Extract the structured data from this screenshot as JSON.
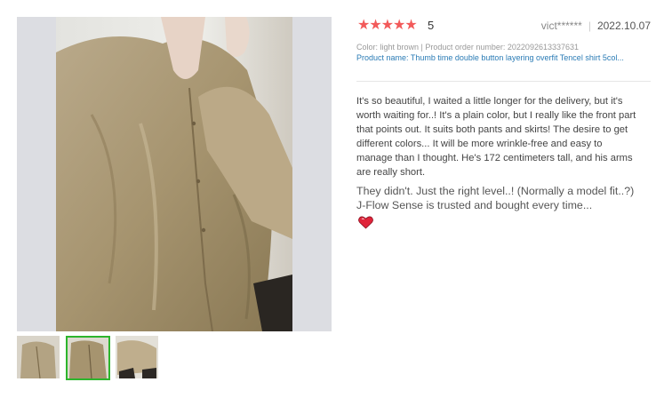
{
  "review": {
    "stars_glyphs": "★★★★★",
    "score": "5",
    "reviewer": "vict******",
    "separator": "|",
    "date": "2022.10.07",
    "order_line": "Color: light brown | Product order number: 2022092613337631",
    "product_line": "Product name: Thumb time double button layering overfit Tencel shirt 5col...",
    "body": "It's so beautiful, I waited a little longer for the delivery, but it's worth waiting for..! It's a plain color, but I really like the front part that points out. It suits both pants and skirts! The desire to get different colors... It will be more wrinkle-free and easy to manage than I thought. He's 172 centimeters tall, and his arms are really short.",
    "body_more": "They didn't. Just the right level..! (Normally a model fit..?) J-Flow Sense is trusted and bought every time..."
  },
  "colors": {
    "star": "#f25a5a",
    "link": "#2a7bb5",
    "selected_thumb_border": "#2db52d",
    "heart": "#e0243a"
  },
  "icons": {
    "rating": "star-icon",
    "emoji": "heart-icon"
  }
}
